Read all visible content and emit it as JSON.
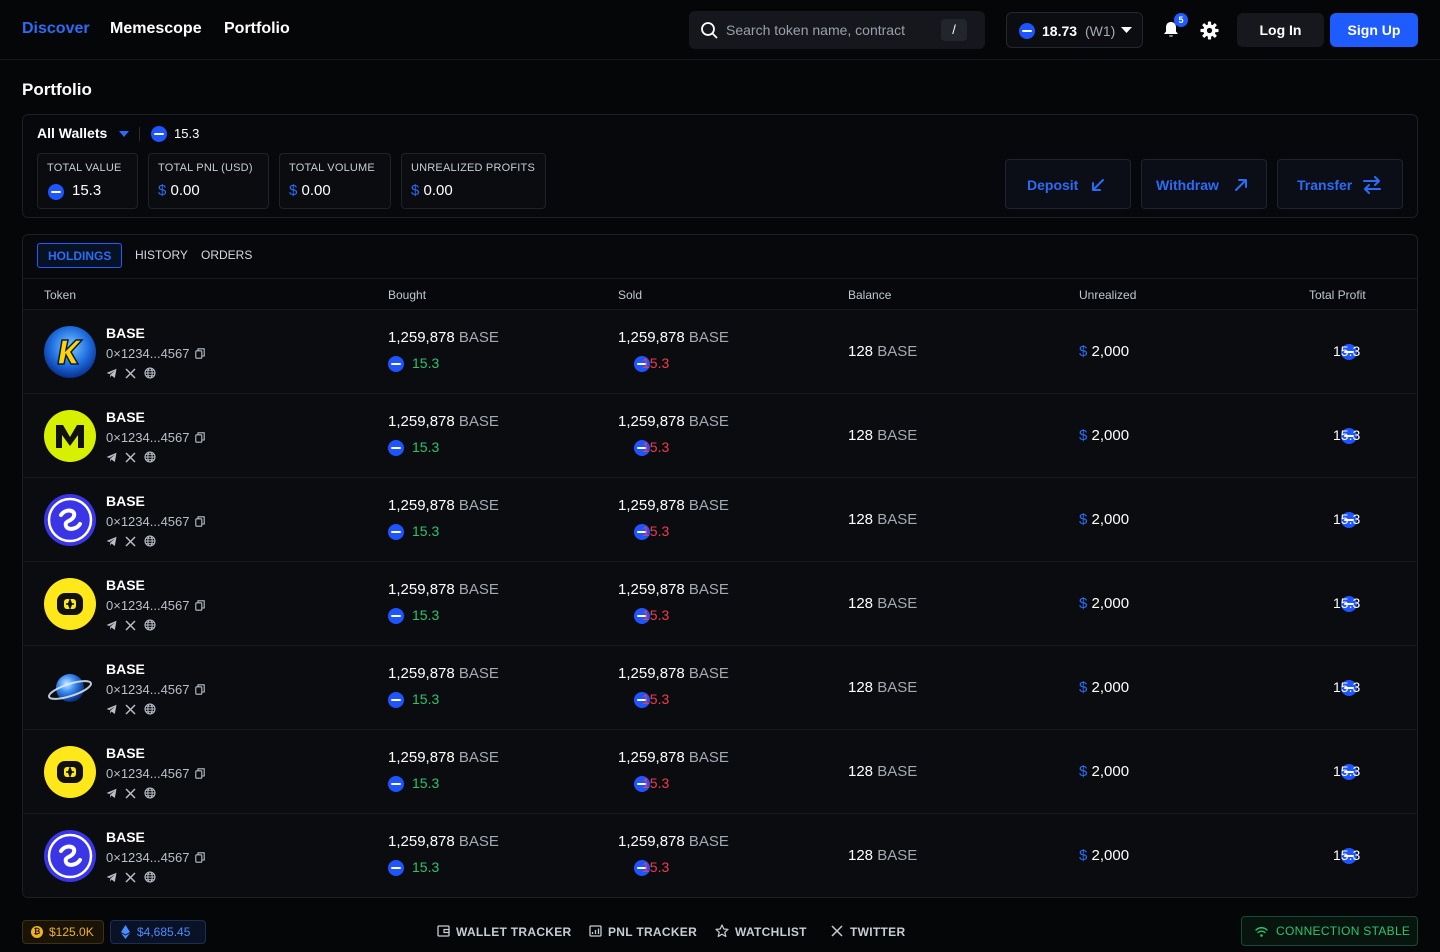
{
  "nav": {
    "discover": "Discover",
    "memescope": "Memescope",
    "portfolio": "Portfolio"
  },
  "search": {
    "placeholder": "Search token name, contract",
    "shortcut": "/"
  },
  "wallet_pill": {
    "amount": "18.73",
    "wallet": "(W1)"
  },
  "notifications": {
    "count": "5"
  },
  "auth": {
    "login": "Log In",
    "signup": "Sign Up"
  },
  "page": {
    "title": "Portfolio"
  },
  "summary": {
    "wallet_select": "All Wallets",
    "wallet_balance": "15.3",
    "stats": [
      {
        "label": "TOTAL VALUE",
        "value": "15.3"
      },
      {
        "label": "TOTAL PNL (USD)",
        "prefix": "$",
        "value": "0.00"
      },
      {
        "label": "TOTAL VOLUME",
        "prefix": "$",
        "value": "0.00"
      },
      {
        "label": "UNREALIZED PROFITS",
        "prefix": "$",
        "value": "0.00"
      }
    ],
    "actions": {
      "deposit": "Deposit",
      "withdraw": "Withdraw",
      "transfer": "Transfer"
    }
  },
  "tabs": {
    "holdings": "HOLDINGS",
    "history": "HISTORY",
    "orders": "ORDERS"
  },
  "columns": {
    "token": "Token",
    "bought": "Bought",
    "sold": "Sold",
    "balance": "Balance",
    "unrealized": "Unrealized",
    "total_profit": "Total Profit"
  },
  "rows": [
    {
      "logo": "k-logo",
      "name": "BASE",
      "address": "0×1234...4567",
      "bought_amount": "1,259,878",
      "bought_unit": "BASE",
      "bought_value": "15.3",
      "sold_amount": "1,259,878",
      "sold_unit": "BASE",
      "sold_value": "15.3",
      "balance": "128",
      "balance_unit": "BASE",
      "unrealized_prefix": "$",
      "unrealized": "2,000",
      "total_profit": "15.3"
    },
    {
      "logo": "m-logo",
      "name": "BASE",
      "address": "0×1234...4567",
      "bought_amount": "1,259,878",
      "bought_unit": "BASE",
      "bought_value": "15.3",
      "sold_amount": "1,259,878",
      "sold_unit": "BASE",
      "sold_value": "15.3",
      "balance": "128",
      "balance_unit": "BASE",
      "unrealized_prefix": "$",
      "unrealized": "2,000",
      "total_profit": "15.3"
    },
    {
      "logo": "swirl-logo",
      "name": "BASE",
      "address": "0×1234...4567",
      "bought_amount": "1,259,878",
      "bought_unit": "BASE",
      "bought_value": "15.3",
      "sold_amount": "1,259,878",
      "sold_unit": "BASE",
      "sold_value": "15.3",
      "balance": "128",
      "balance_unit": "BASE",
      "unrealized_prefix": "$",
      "unrealized": "2,000",
      "total_profit": "15.3"
    },
    {
      "logo": "yellow-square-logo",
      "name": "BASE",
      "address": "0×1234...4567",
      "bought_amount": "1,259,878",
      "bought_unit": "BASE",
      "bought_value": "15.3",
      "sold_amount": "1,259,878",
      "sold_unit": "BASE",
      "sold_value": "15.3",
      "balance": "128",
      "balance_unit": "BASE",
      "unrealized_prefix": "$",
      "unrealized": "2,000",
      "total_profit": "15.3"
    },
    {
      "logo": "planet-logo",
      "name": "BASE",
      "address": "0×1234...4567",
      "bought_amount": "1,259,878",
      "bought_unit": "BASE",
      "bought_value": "15.3",
      "sold_amount": "1,259,878",
      "sold_unit": "BASE",
      "sold_value": "15.3",
      "balance": "128",
      "balance_unit": "BASE",
      "unrealized_prefix": "$",
      "unrealized": "2,000",
      "total_profit": "15.3"
    },
    {
      "logo": "yellow-square-logo",
      "name": "BASE",
      "address": "0×1234...4567",
      "bought_amount": "1,259,878",
      "bought_unit": "BASE",
      "bought_value": "15.3",
      "sold_amount": "1,259,878",
      "sold_unit": "BASE",
      "sold_value": "15.3",
      "balance": "128",
      "balance_unit": "BASE",
      "unrealized_prefix": "$",
      "unrealized": "2,000",
      "total_profit": "15.3"
    },
    {
      "logo": "swirl-logo",
      "name": "BASE",
      "address": "0×1234...4567",
      "bought_amount": "1,259,878",
      "bought_unit": "BASE",
      "bought_value": "15.3",
      "sold_amount": "1,259,878",
      "sold_unit": "BASE",
      "sold_value": "15.3",
      "balance": "128",
      "balance_unit": "BASE",
      "unrealized_prefix": "$",
      "unrealized": "2,000",
      "total_profit": "15.3"
    }
  ],
  "footer": {
    "btc_price": "$125.0K",
    "eth_price": "$4,685.45",
    "links": {
      "wallet_tracker": "WALLET TRACKER",
      "pnl_tracker": "PNL TRACKER",
      "watchlist": "WATCHLIST",
      "twitter": "TWITTER"
    },
    "connection": "CONNECTION STABLE"
  },
  "colors": {
    "accent": "#1e5cff",
    "positive": "#2cc36b",
    "negative": "#f23a4a",
    "background": "#050608"
  }
}
